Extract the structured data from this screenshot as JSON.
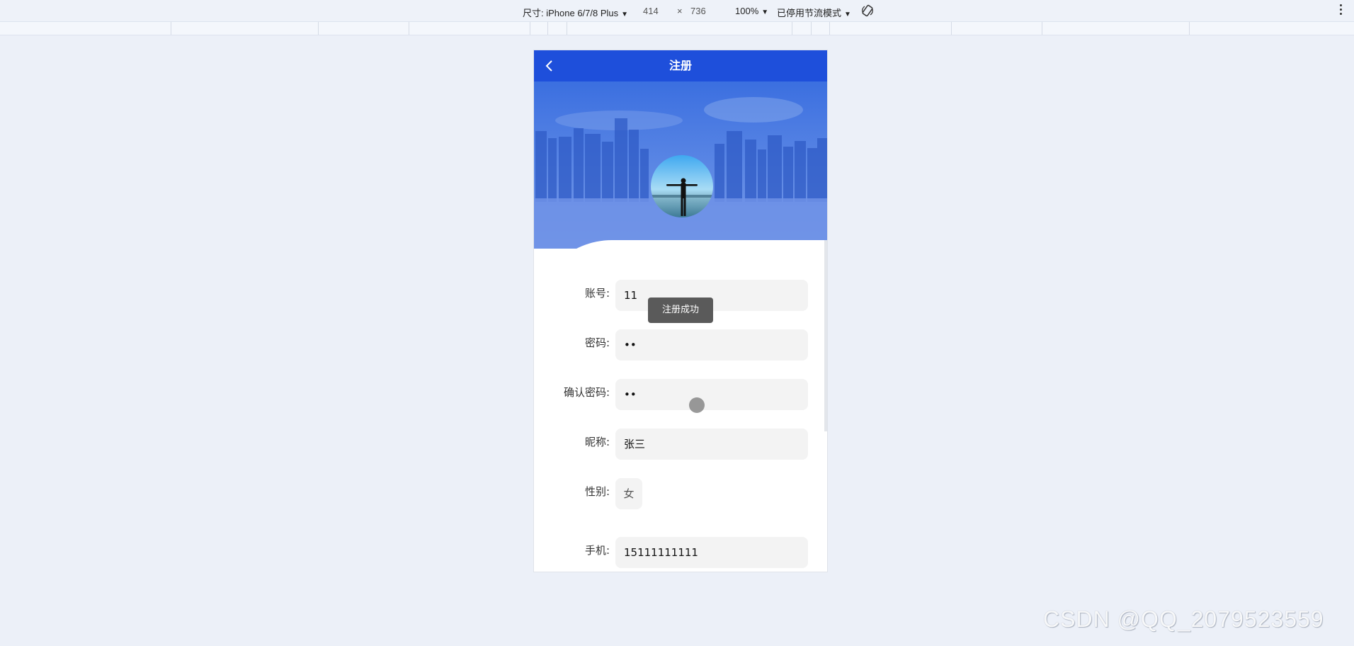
{
  "devtools": {
    "size_label": "尺寸: iPhone 6/7/8 Plus",
    "width": "414",
    "times": "×",
    "height": "736",
    "zoom": "100%",
    "throttle": "已停用节流模式"
  },
  "nav": {
    "title": "注册"
  },
  "toast": {
    "text": "注册成功"
  },
  "form": {
    "account": {
      "label": "账号:",
      "value": "11"
    },
    "password": {
      "label": "密码:",
      "value": "••"
    },
    "confirm": {
      "label": "确认密码:",
      "value": "••"
    },
    "nickname": {
      "label": "昵称:",
      "value": "张三"
    },
    "gender": {
      "label": "性别:",
      "value": "女"
    },
    "phone": {
      "label": "手机:",
      "value": "15111111111"
    }
  },
  "watermark": "CSDN @QQ_2079523559",
  "colors": {
    "nav": "#1e4fdb",
    "page_bg": "#ecf0f8",
    "input_bg": "#f3f3f3",
    "toast_bg": "#5a5a5a"
  },
  "icons": {
    "back": "chevron-left-icon",
    "rotate": "rotate-icon",
    "more": "more-vertical-icon"
  }
}
